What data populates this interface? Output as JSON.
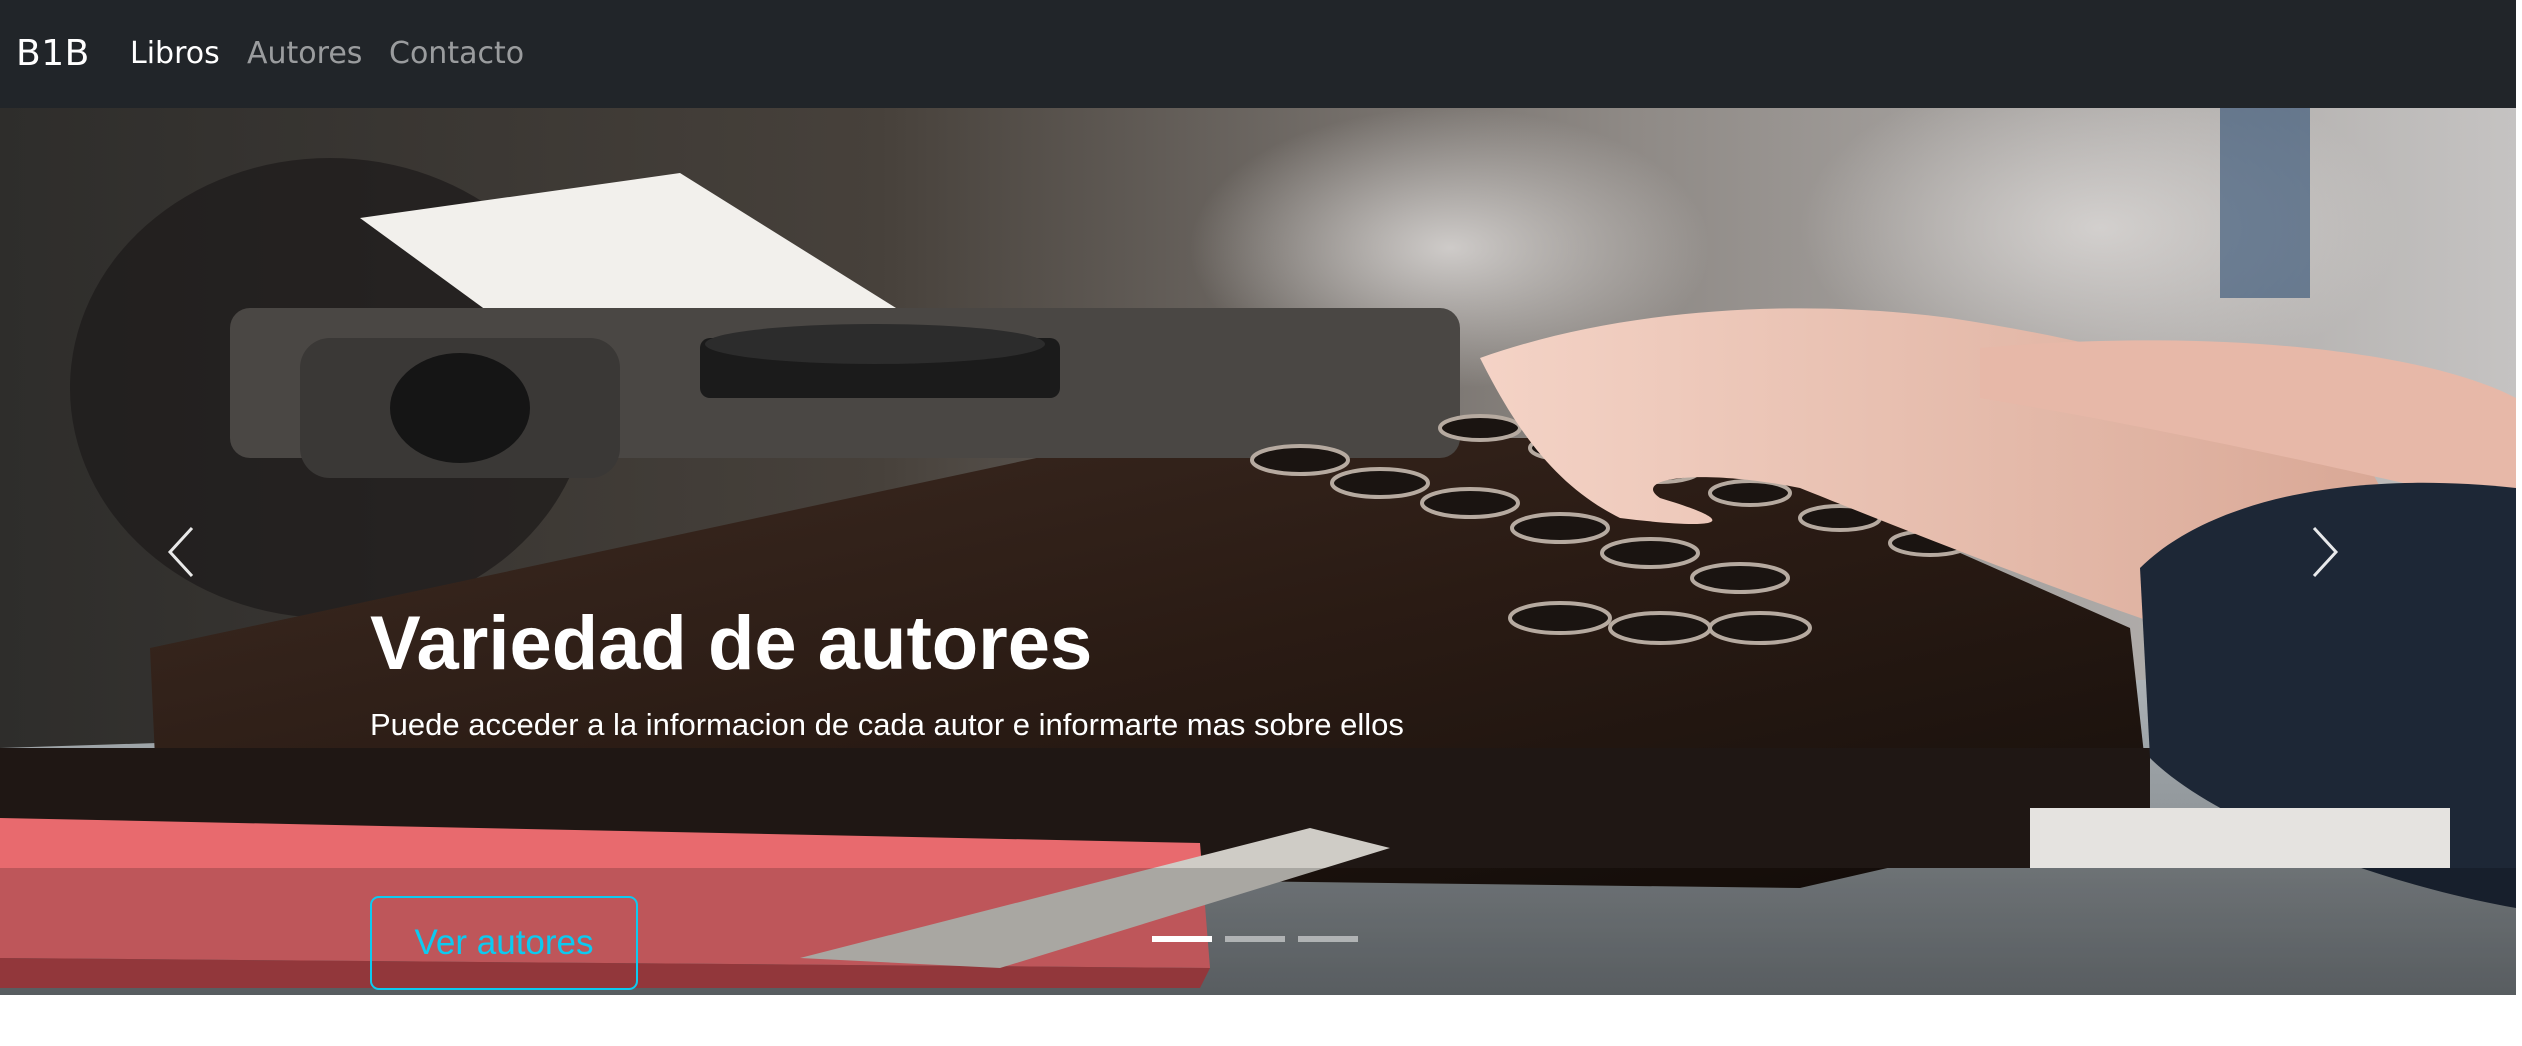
{
  "navbar": {
    "brand": "B1B",
    "links": [
      {
        "label": "Libros",
        "active": true
      },
      {
        "label": "Autores",
        "active": false
      },
      {
        "label": "Contacto",
        "active": false
      }
    ]
  },
  "carousel": {
    "slide": {
      "image_icon": "typewriter-photo",
      "title": "Variedad de autores",
      "text": "Puede acceder a la informacion de cada autor e informarte mas sobre ellos",
      "button_label": "Ver autores"
    },
    "controls": {
      "prev_icon": "chevron-left-icon",
      "next_icon": "chevron-right-icon"
    },
    "indicators": [
      {
        "active": true
      },
      {
        "active": false
      },
      {
        "active": false
      }
    ]
  },
  "colors": {
    "navbar_bg": "#212529",
    "button_accent": "#0dcaf0"
  }
}
